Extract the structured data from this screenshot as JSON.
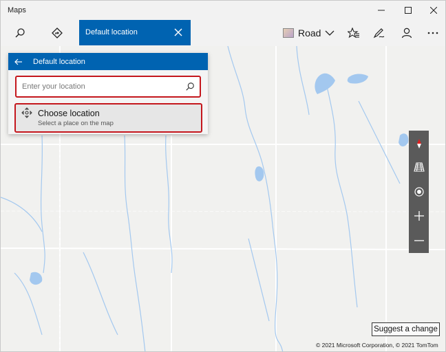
{
  "window": {
    "title": "Maps"
  },
  "toolbar": {
    "search_tab_label": "Default location",
    "map_style_label": "Road"
  },
  "panel": {
    "header_title": "Default location",
    "search_placeholder": "Enter your location",
    "choose_title": "Choose location",
    "choose_subtitle": "Select a place on the map"
  },
  "map": {
    "suggest_label": "Suggest a change",
    "copyright": "© 2021 Microsoft Corporation, © 2021 TomTom"
  },
  "icons": {
    "search": "search-icon",
    "directions": "directions-icon",
    "close": "close-icon",
    "chevron": "chevron-down-icon",
    "favorites": "favorites-icon",
    "ink": "ink-icon",
    "account": "account-icon",
    "more": "more-icon",
    "back": "back-arrow-icon",
    "choose": "crosshair-icon",
    "compass": "compass-icon",
    "tilt": "tilt-icon",
    "location": "my-location-icon",
    "zoom_in": "zoom-in-icon",
    "zoom_out": "zoom-out-icon"
  },
  "colors": {
    "accent": "#0063b1",
    "highlight": "#c4161c",
    "water": "#a3c8ef",
    "controls": "#5a5a5a"
  }
}
